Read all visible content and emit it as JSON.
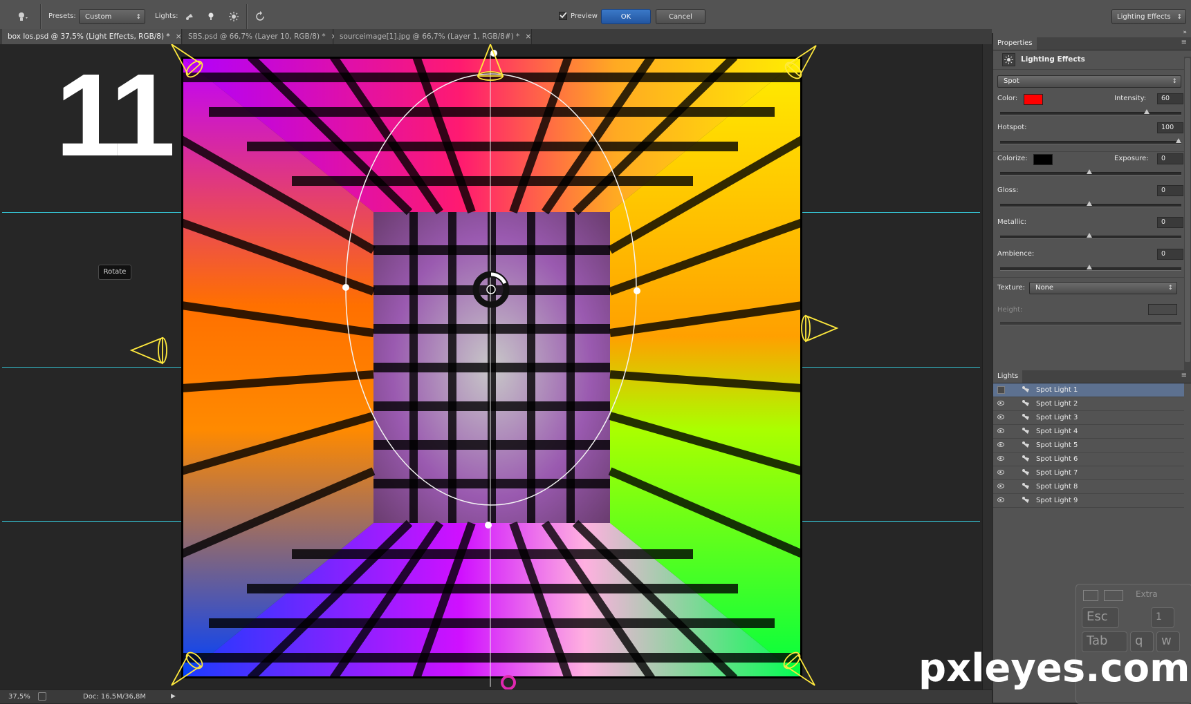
{
  "options_bar": {
    "presets_label": "Presets:",
    "presets_value": "Custom",
    "lights_label": "Lights:",
    "preview_label": "Preview",
    "preview_checked": true,
    "ok_label": "OK",
    "cancel_label": "Cancel",
    "workspace_value": "Lighting Effects"
  },
  "tabs": [
    {
      "label": "box los.psd @ 37,5% (Light Effects, RGB/8) *",
      "close": "×"
    },
    {
      "label": "SBS.psd @ 66,7% (Layer 10, RGB/8) *",
      "close": "×"
    },
    {
      "label": "sourceimage[1].jpg @ 66,7% (Layer 1, RGB/8#) *",
      "close": "×"
    }
  ],
  "canvas": {
    "step_number": "11",
    "tooltip": "Rotate",
    "watermark": "pxleyes.com"
  },
  "status": {
    "zoom": "37,5%",
    "doc": "Doc: 16,5M/36,8M"
  },
  "properties": {
    "panel_title": "Properties",
    "section_title": "Lighting Effects",
    "light_type": "Spot",
    "color_label": "Color:",
    "color_value": "#ff0000",
    "intensity_label": "Intensity:",
    "intensity_value": "60",
    "hotspot_label": "Hotspot:",
    "hotspot_value": "100",
    "colorize_label": "Colorize:",
    "colorize_value": "#000000",
    "exposure_label": "Exposure:",
    "exposure_value": "0",
    "gloss_label": "Gloss:",
    "gloss_value": "0",
    "metallic_label": "Metallic:",
    "metallic_value": "0",
    "ambience_label": "Ambience:",
    "ambience_value": "0",
    "texture_label": "Texture:",
    "texture_value": "None",
    "height_label": "Height:",
    "sliders": {
      "intensity": 0.82,
      "hotspot": 1.0,
      "exposure": 0.5,
      "gloss": 0.5,
      "metallic": 0.5,
      "ambience": 0.5
    }
  },
  "lights_panel": {
    "title": "Lights",
    "items": [
      {
        "label": "Spot Light 1",
        "selected": true,
        "visible": false
      },
      {
        "label": "Spot Light 2",
        "selected": false,
        "visible": true
      },
      {
        "label": "Spot Light 3",
        "selected": false,
        "visible": true
      },
      {
        "label": "Spot Light 4",
        "selected": false,
        "visible": true
      },
      {
        "label": "Spot Light 5",
        "selected": false,
        "visible": true
      },
      {
        "label": "Spot Light 6",
        "selected": false,
        "visible": true
      },
      {
        "label": "Spot Light 7",
        "selected": false,
        "visible": true
      },
      {
        "label": "Spot Light 8",
        "selected": false,
        "visible": true
      },
      {
        "label": "Spot Light 9",
        "selected": false,
        "visible": true
      }
    ]
  },
  "keyboard_overlay": {
    "extra_label": "Extra",
    "keys": [
      "Esc",
      "Tab",
      "q",
      "w",
      "1"
    ]
  }
}
